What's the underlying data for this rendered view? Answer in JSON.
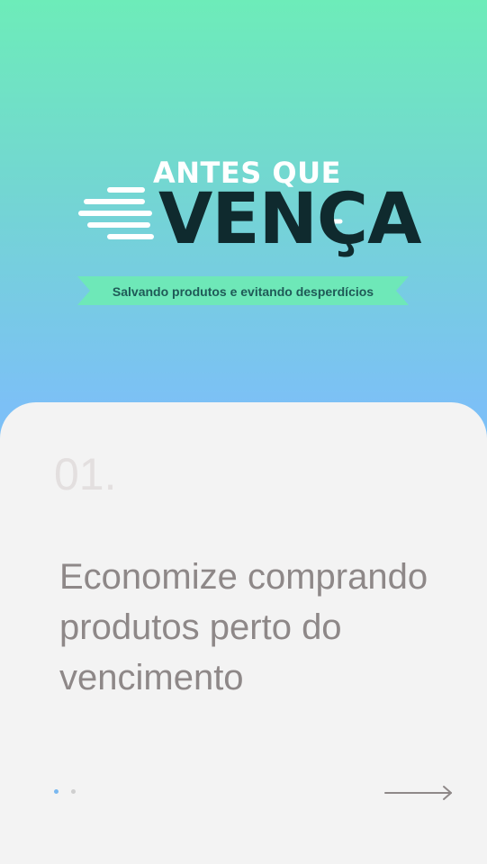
{
  "brand": {
    "title_top": "ANTES QUE",
    "title_main": "VENÇA",
    "tagline": "Salvando produtos e evitando desperdícios",
    "ribbon_color": "#6ee8b8",
    "dark_color": "#0f2a2e"
  },
  "onboarding": {
    "step_number": "01.",
    "headline": "Economize comprando produtos perto do vencimento",
    "page_count": 2,
    "active_page": 1,
    "next_icon": "arrow-right-icon"
  }
}
